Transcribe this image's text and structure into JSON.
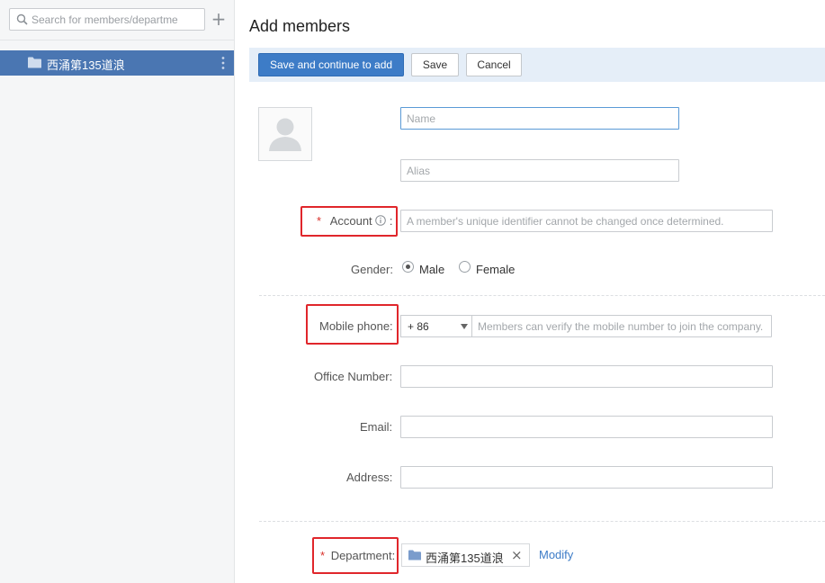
{
  "sidebar": {
    "search_placeholder": "Search for members/departme",
    "add_symbol": "+",
    "department_name": "西涌第135道浪"
  },
  "main": {
    "title": "Add members",
    "toolbar": {
      "save_continue_label": "Save and continue to add",
      "save_label": "Save",
      "cancel_label": "Cancel"
    },
    "form": {
      "name_placeholder": "Name",
      "alias_placeholder": "Alias",
      "required_mark": "*",
      "account_label": "Account",
      "account_colon": ":",
      "account_placeholder": "A member's unique identifier cannot be changed once determined.",
      "gender_label": "Gender:",
      "gender_options": [
        "Male",
        "Female"
      ],
      "gender_selected": "Male",
      "mobile_label": "Mobile phone:",
      "country_code": "+ 86",
      "mobile_placeholder": "Members can verify the mobile number to join the company.",
      "office_label": "Office Number:",
      "email_label": "Email:",
      "address_label": "Address:",
      "department_label": "Department:",
      "department_tag": "西涌第135道浪",
      "department_remove": "×",
      "modify_label": "Modify"
    }
  },
  "colors": {
    "sidebar_selected": "#4a76b2",
    "primary_button": "#3d7cc7",
    "highlight_box": "#e0262b",
    "required": "#d9302a",
    "toolbar_bg": "#e5eef8"
  }
}
